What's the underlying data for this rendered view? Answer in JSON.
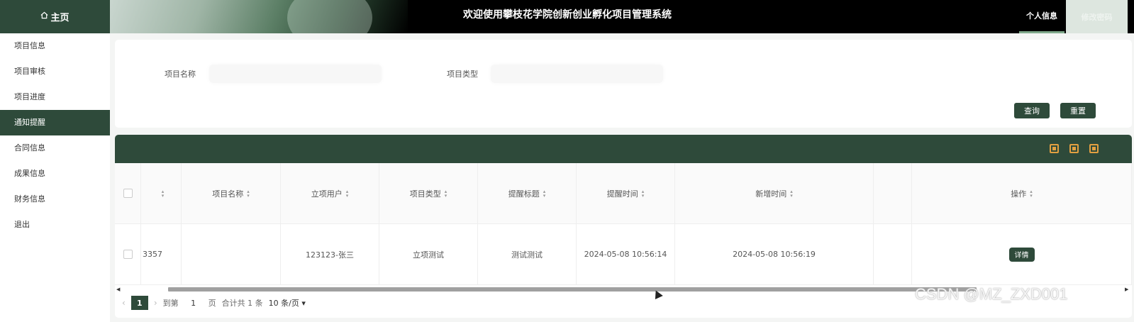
{
  "header": {
    "home_label": "主页",
    "home_icon": "home-icon",
    "title": "欢迎使用攀枝花学院创新创业孵化项目管理系统",
    "profile_tab": "个人信息",
    "password_tab": "修改密码"
  },
  "sidebar": {
    "items": [
      {
        "label": "项目信息"
      },
      {
        "label": "项目审核"
      },
      {
        "label": "项目进度"
      },
      {
        "label": "通知提醒",
        "active": true
      },
      {
        "label": "合同信息"
      },
      {
        "label": "成果信息"
      },
      {
        "label": "财务信息"
      },
      {
        "label": "退出"
      }
    ]
  },
  "search": {
    "name_label": "项目名称",
    "type_label": "项目类型",
    "query_button": "查询",
    "reset_button": "重置"
  },
  "toolbar": {
    "icons": [
      "delete-icon",
      "export-icon",
      "print-icon"
    ]
  },
  "table": {
    "columns": [
      "项目名称",
      "立项用户",
      "项目类型",
      "提醒标题",
      "提醒时间",
      "新增时间",
      "操作"
    ],
    "rows": [
      {
        "id_fragment": "3357",
        "project_name": "",
        "user": "123123-张三",
        "type": "立项测试",
        "reminder_title": "测试测试",
        "reminder_time": "2024-05-08 10:56:14",
        "added_time": "2024-05-08 10:56:19",
        "action": "详情"
      }
    ]
  },
  "pager": {
    "current": "1",
    "goto_label": "到第",
    "goto_value": "1",
    "page_suffix": "页",
    "total": "合计共 1 条",
    "page_size": "10 条/页"
  },
  "watermark": "CSDN @MZ_ZXD001"
}
